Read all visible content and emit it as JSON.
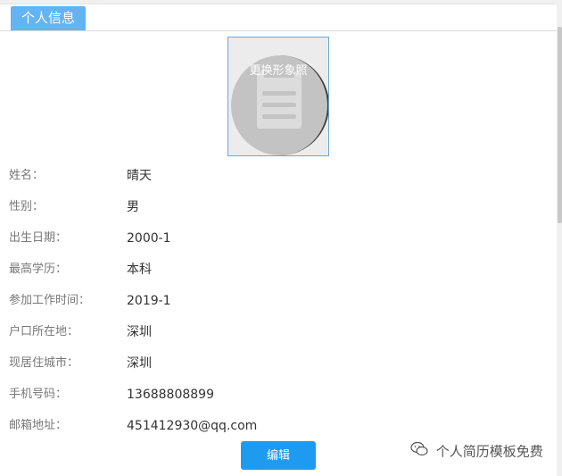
{
  "section": {
    "title": "个人信息"
  },
  "photo": {
    "overlay_text": "更换形象照",
    "icon": "document-placeholder-icon"
  },
  "fields": [
    {
      "label": "姓名：",
      "value": "晴天"
    },
    {
      "label": "性别：",
      "value": "男"
    },
    {
      "label": "出生日期：",
      "value": "2000-1"
    },
    {
      "label": "最高学历：",
      "value": "本科"
    },
    {
      "label": "参加工作时间：",
      "value": "2019-1"
    },
    {
      "label": "户口所在地：",
      "value": "深圳"
    },
    {
      "label": "现居住城市：",
      "value": "深圳"
    },
    {
      "label": "手机号码：",
      "value": "13688808899"
    },
    {
      "label": "邮箱地址：",
      "value": "451412930@qq.com"
    }
  ],
  "actions": {
    "edit_label": "编辑"
  },
  "watermark": {
    "text": "个人简历模板免费"
  },
  "colors": {
    "accent": "#62b4f2",
    "button": "#1e9bf0"
  }
}
